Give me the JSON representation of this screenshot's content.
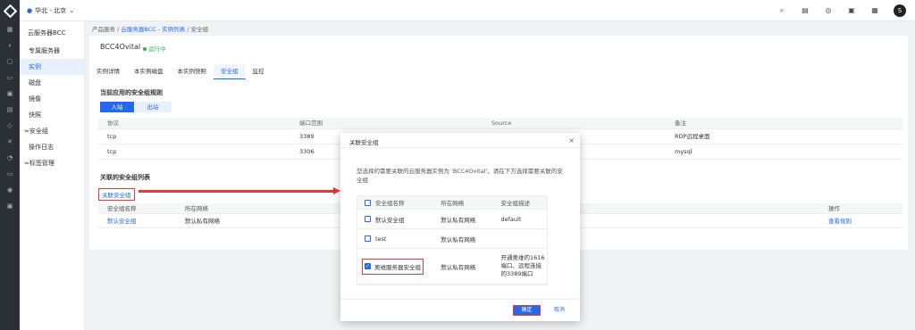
{
  "topbar": {
    "region": "华北 - 北京",
    "icons": [
      "search-icon",
      "document-icon",
      "help-icon",
      "message-icon",
      "pin-icon"
    ],
    "avatar": "S"
  },
  "rail": [
    "console-icon",
    "expand-icon",
    "product-icon",
    "network-icon",
    "storage-icon",
    "database-icon",
    "security-icon",
    "ai-icon",
    "monitor-icon",
    "tag-icon",
    "setting-icon"
  ],
  "sidebar": {
    "title": "云服务器BCC",
    "items": [
      {
        "label": "专属服务器",
        "active": false
      },
      {
        "label": "实例",
        "active": true
      },
      {
        "label": "磁盘",
        "active": false
      },
      {
        "label": "镜像",
        "active": false
      },
      {
        "label": "快照",
        "active": false
      },
      {
        "label": "安全组",
        "active": false
      },
      {
        "label": "操作日志",
        "active": false
      },
      {
        "label": "标签管理",
        "active": false
      }
    ]
  },
  "breadcrumb": {
    "root": "产品服务",
    "sep": "/",
    "link": "云服务器BCC - 实例列表",
    "current": "安全组"
  },
  "instance": {
    "name": "BCC4Ovital",
    "status": "运行中"
  },
  "tabs": [
    "实例详情",
    "本实例磁盘",
    "本实例快照",
    "安全组",
    "监控"
  ],
  "rules": {
    "title": "当前应用的安全组规则",
    "btn_in": "入站",
    "btn_out": "出站",
    "headers": [
      "协议",
      "端口范围",
      "Source",
      "备注"
    ],
    "rows": [
      [
        "tcp",
        "3389",
        "",
        "RDP远程桌面"
      ],
      [
        "tcp",
        "3306",
        "",
        "mysql"
      ]
    ]
  },
  "assoc": {
    "title": "关联的安全组列表",
    "link": "关联安全组",
    "headers": [
      "安全组名称",
      "所在网络",
      "操作"
    ],
    "rows": [
      [
        "默认安全组",
        "默认私有网络",
        "查看规则"
      ]
    ]
  },
  "modal": {
    "title": "关联安全组",
    "close": "×",
    "desc": "您选择的需要关联的云服务器实例为 'BCC4Ovital'，请在下方选择需要关联的安全组",
    "headers": [
      "安全组名称",
      "所在网络",
      "安全组描述"
    ],
    "rows": [
      {
        "name": "默认安全组",
        "net": "默认私有网络",
        "desc": "default",
        "checked": false
      },
      {
        "name": "test",
        "net": "默认私有网络",
        "desc": "",
        "checked": false
      },
      {
        "name": "奥维服务器安全组",
        "net": "默认私有网络",
        "desc": "开通奥维的1616端口、远程连接的3389端口",
        "checked": true
      }
    ],
    "ok": "确定",
    "cancel": "取消"
  },
  "colors": {
    "primary": "#2468f2",
    "highlight": "#e53935",
    "status": "#2aaf55"
  }
}
